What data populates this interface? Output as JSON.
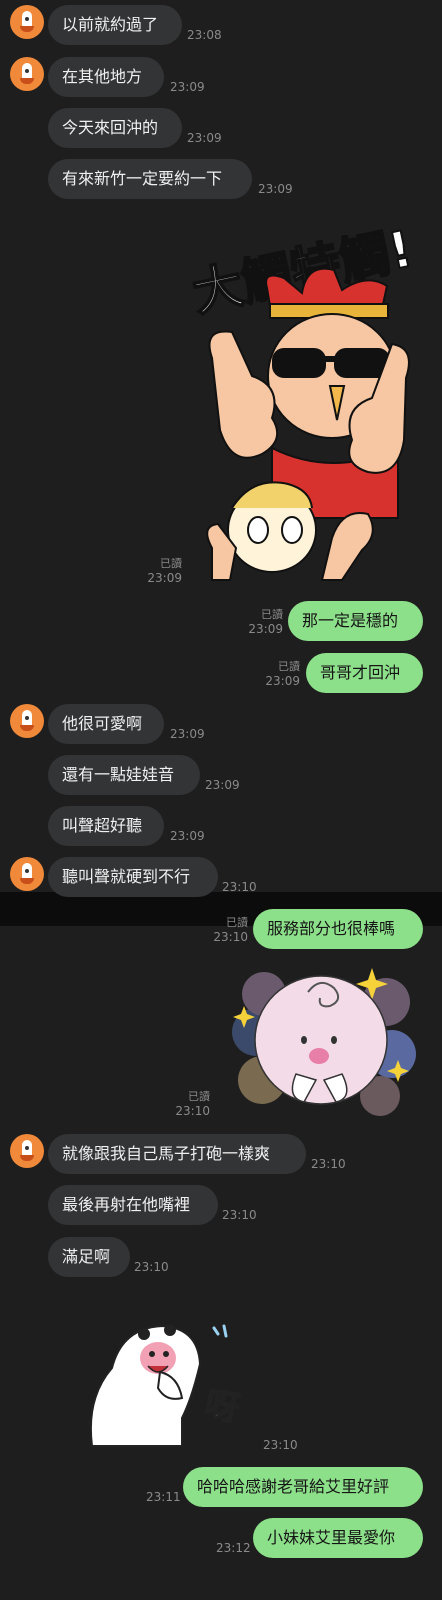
{
  "chat": {
    "m1": {
      "text": "以前就約過了",
      "time": "23:08"
    },
    "m2": {
      "text": "在其他地方",
      "time": "23:09"
    },
    "m3": {
      "text": "今天來回沖的",
      "time": "23:09"
    },
    "m4": {
      "text": "有來新竹一定要約一下",
      "time": "23:09"
    },
    "s1": {
      "caption": "大觸特觸!",
      "read": "已讀",
      "time": "23:09"
    },
    "o1": {
      "text": "那一定是穩的",
      "read": "已讀",
      "time": "23:09"
    },
    "o2": {
      "text": "哥哥才回沖",
      "read": "已讀",
      "time": "23:09"
    },
    "m5": {
      "text": "他很可愛啊",
      "time": "23:09"
    },
    "m6": {
      "text": "還有一點娃娃音",
      "time": "23:09"
    },
    "m7": {
      "text": "叫聲超好聽",
      "time": "23:09"
    },
    "m8": {
      "text": "聽叫聲就硬到不行",
      "time": "23:10"
    },
    "o3": {
      "text": "服務部分也很棒嗎",
      "read": "已讀",
      "time": "23:10"
    },
    "s2": {
      "read": "已讀",
      "time": "23:10"
    },
    "m9": {
      "text": "就像跟我自己馬子打砲一樣爽",
      "time": "23:10"
    },
    "m10": {
      "text": "最後再射在他嘴裡",
      "time": "23:10"
    },
    "m11": {
      "text": "滿足啊",
      "time": "23:10"
    },
    "s3": {
      "caption": "呀",
      "time": "23:10"
    },
    "o4": {
      "text": "哈哈哈感謝老哥給艾里好評",
      "time": "23:11"
    },
    "o5": {
      "text": "小妹妹艾里最愛你",
      "time": "23:12"
    }
  },
  "colors": {
    "background": "#1e1e1e",
    "incoming": "#333436",
    "outgoing": "#8de08a",
    "avatar": "#f08a3a"
  },
  "icons": {
    "avatar": "contact-avatar-icon"
  }
}
